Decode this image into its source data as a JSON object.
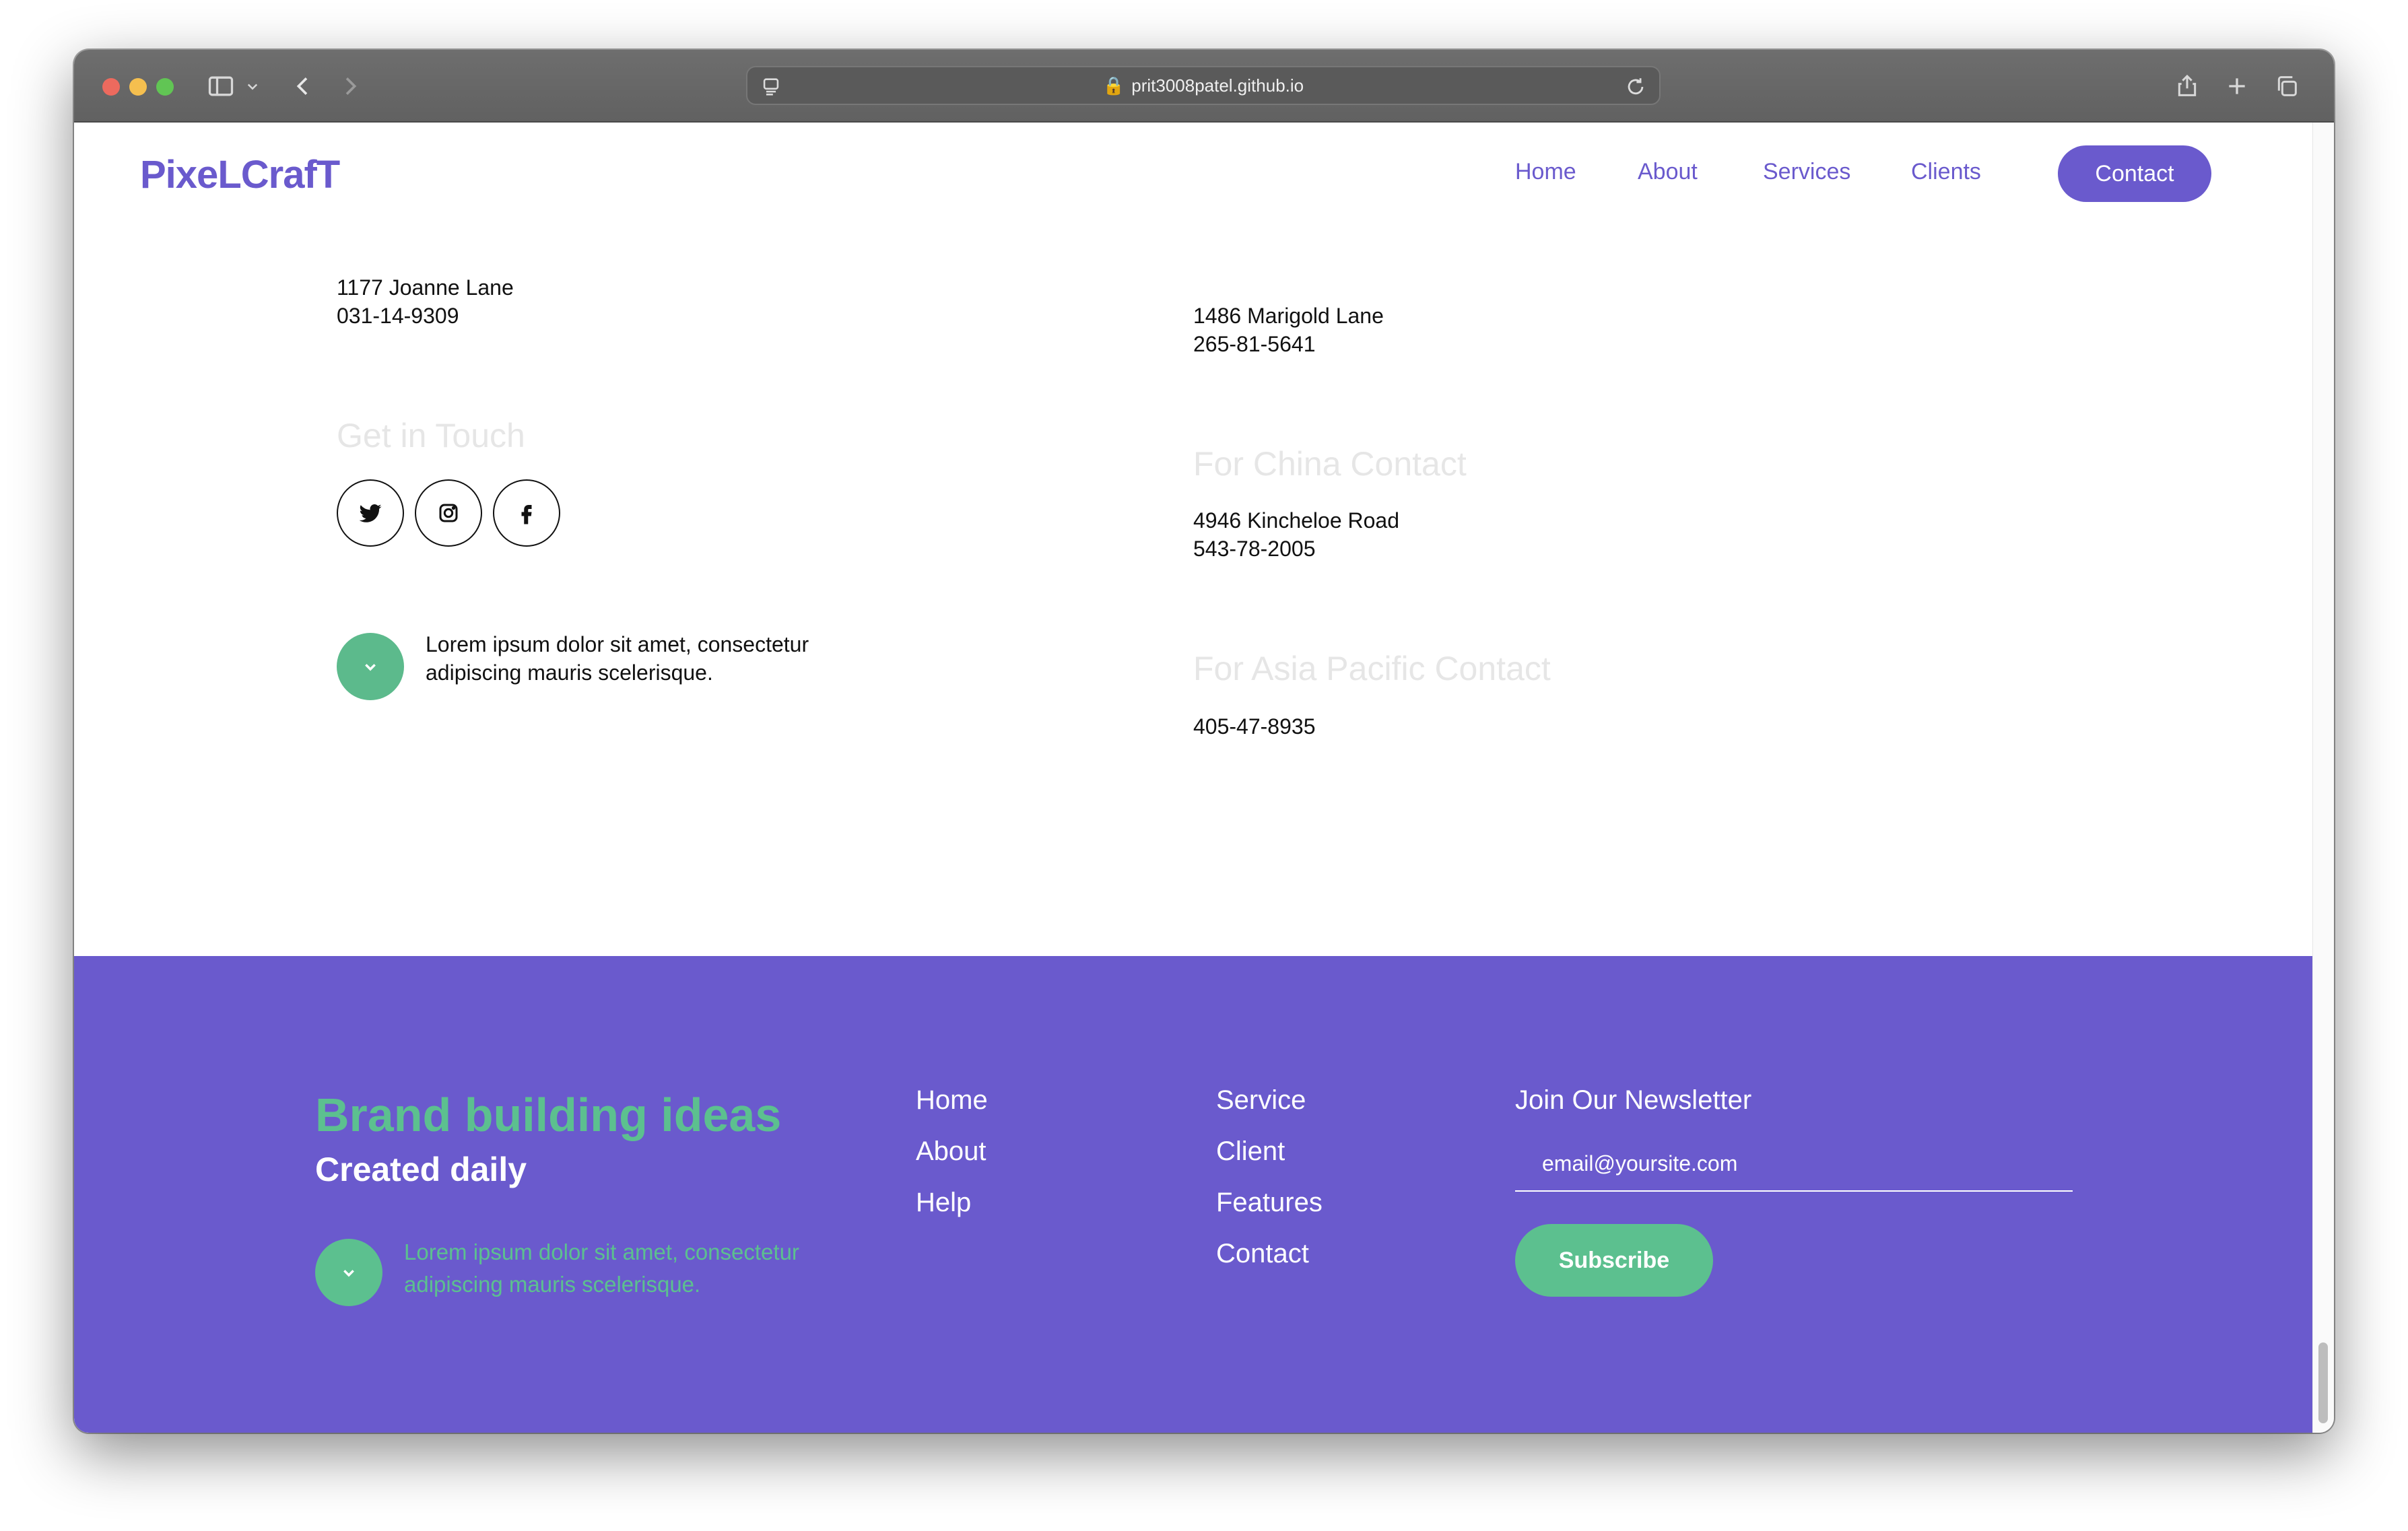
{
  "browser": {
    "url": "prit3008patel.github.io"
  },
  "header": {
    "logo": "PixeLCrafT",
    "nav": [
      "Home",
      "About",
      "Services",
      "Clients"
    ],
    "contact_label": "Contact"
  },
  "offices": {
    "left_address": "1177 Joanne Lane",
    "left_phone": "031-14-9309",
    "right_address": "1486 Marigold Lane",
    "right_phone": "265-81-5641",
    "china_title": "For China Contact",
    "china_address": "4946 Kincheloe Road",
    "china_phone": "543-78-2005",
    "asia_title": "For Asia Pacific Contact",
    "asia_phone": "405-47-8935"
  },
  "get_in_touch": {
    "title": "Get in Touch",
    "icons": [
      "twitter-icon",
      "instagram-icon",
      "facebook-icon"
    ]
  },
  "lorem": {
    "line1": "Lorem ipsum dolor sit amet, consectetur",
    "line2": "adipiscing mauris scelerisque."
  },
  "footer": {
    "brand_title": "Brand building ideas",
    "brand_sub": "Created daily",
    "lorem_line1": "Lorem ipsum dolor sit amet, consectetur",
    "lorem_line2": "adipiscing mauris scelerisque.",
    "col1": [
      "Home",
      "About",
      "Help"
    ],
    "col2": [
      "Service",
      "Client",
      "Features",
      "Contact"
    ],
    "newsletter_title": "Join Our Newsletter",
    "email_placeholder": "email@yoursite.com",
    "subscribe_label": "Subscribe"
  },
  "colors": {
    "brand": "#6a5acd",
    "accent_green": "#5cc08f",
    "heading_faint": "#e6e6e6"
  }
}
